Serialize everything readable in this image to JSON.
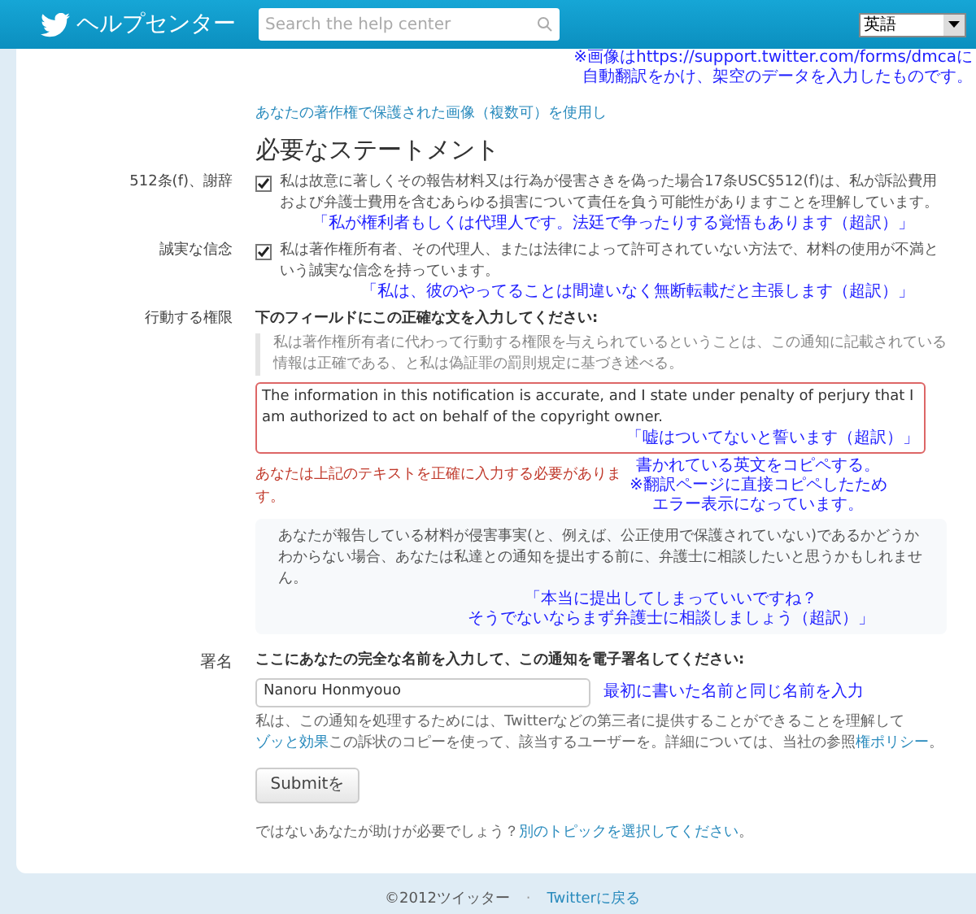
{
  "header": {
    "title": "ヘルプセンター",
    "search_placeholder": "Search the help center",
    "language": "英語"
  },
  "overlay_note": [
    "※画像はhttps://support.twitter.com/forms/dmcaに",
    "自動翻訳をかけ、架空のデータを入力したものです。"
  ],
  "report_link": "あなたの著作権で保護された画像（複数可）を使用し",
  "section_title": "必要なステートメント",
  "statements": [
    {
      "label": "512条(f)、謝辞",
      "checked": true,
      "text": "私は故意に著しくその報告材料又は行為が侵害さきを偽った場合17条USC§512(f)は、私が訴訟費用および弁護士費用を含むあらゆる損害について責任を負う可能性がありますことを理解しています。",
      "note": "「私が権利者もしくは代理人です。法廷で争ったりする覚悟もあります（超訳）」"
    },
    {
      "label": "誠実な信念",
      "checked": true,
      "text": "私は著作権所有者、その代理人、または法律によって許可されていない方法で、材料の使用が不満という誠実な信念を持っています。",
      "note": "「私は、彼のやってることは間違いなく無断転載だと主張します（超訳）」"
    }
  ],
  "authority": {
    "label": "行動する権限",
    "instruction": "下のフィールドにこの正確な文を入力してください:",
    "quote": "私は著作権所有者に代わって行動する権限を与えられているということは、この通知に記載されている情報は正確である、と私は偽証罪の罰則規定に基づき述べる。",
    "value": "The information in this notification is accurate, and I state under penalty of perjury that I am authorized to act on behalf of the copyright owner.",
    "field_note": "「嘘はついてないと誓います（超訳）」",
    "error": "あなたは上記のテキストを正確に入力する必要があります。",
    "notes": [
      "書かれている英文をコピペする。",
      "※翻訳ページに直接コピペしたため",
      "エラー表示になっています。"
    ],
    "info": "あなたが報告している材料が侵害事実(と、例えば、公正使用で保護されていない)であるかどうかわからない場合、あなたは私達との通知を提出する前に、弁護士に相談したいと思うかもしれません。",
    "info_notes": [
      "「本当に提出してしまっていいですね？",
      "そうでないならまず弁護士に相談しましょう（超訳）」"
    ]
  },
  "signature": {
    "label": "署名",
    "instruction": "ここにあなたの完全な名前を入力して、この通知を電子署名してください:",
    "value": "Nanoru Honmyouo",
    "note": "最初に書いた名前と同じ名前を入力",
    "help": [
      {
        "kind": "text",
        "text": "私は、この通知を処理するためには、Twitterなどの第三者に提供することができることを理解して"
      },
      {
        "kind": "link",
        "text": "ゾッと効果"
      },
      {
        "kind": "text",
        "text": "この訴状のコピーを使って、該当するユーザーを。詳細については、当社の参照"
      },
      {
        "kind": "link",
        "text": "権ポリシー"
      },
      {
        "kind": "text",
        "text": "。"
      }
    ]
  },
  "submit": "Submitを",
  "help_line": [
    {
      "kind": "text",
      "text": "ではないあなたが助けが必要でしょう？"
    },
    {
      "kind": "link",
      "text": "別のトピックを選択してください"
    },
    {
      "kind": "text",
      "text": "。"
    }
  ],
  "footer": {
    "copyright": "©2012ツイッター",
    "separator": "·",
    "back_link": "Twitterに戻る"
  }
}
